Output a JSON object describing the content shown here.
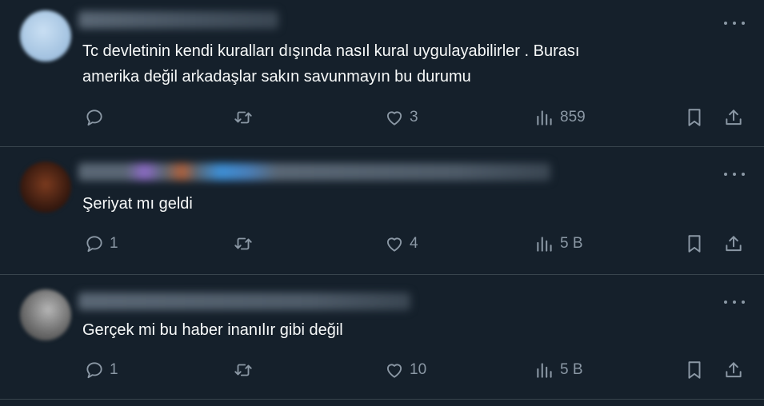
{
  "colors": {
    "background": "#15202b",
    "text": "#f7f9f9",
    "secondary": "#8b98a5",
    "divider": "#38444d"
  },
  "replies": [
    {
      "text": "Tc devletinin kendi kuralları dışında nasıl kural uygulayabilirler . Burası\namerika değil arkadaşlar sakın savunmayın bu durumu",
      "reply_count": "",
      "retweet_count": "",
      "like_count": "3",
      "view_count": "859"
    },
    {
      "text": "Şeriyat mı geldi",
      "reply_count": "1",
      "retweet_count": "",
      "like_count": "4",
      "view_count": "5 B"
    },
    {
      "text": "Gerçek mi bu haber inanılır gibi değil",
      "reply_count": "1",
      "retweet_count": "",
      "like_count": "10",
      "view_count": "5 B"
    }
  ],
  "icons": {
    "reply": "reply-icon",
    "retweet": "retweet-icon",
    "like": "like-icon",
    "views": "views-icon",
    "bookmark": "bookmark-icon",
    "share": "share-icon",
    "more": "more-icon"
  }
}
